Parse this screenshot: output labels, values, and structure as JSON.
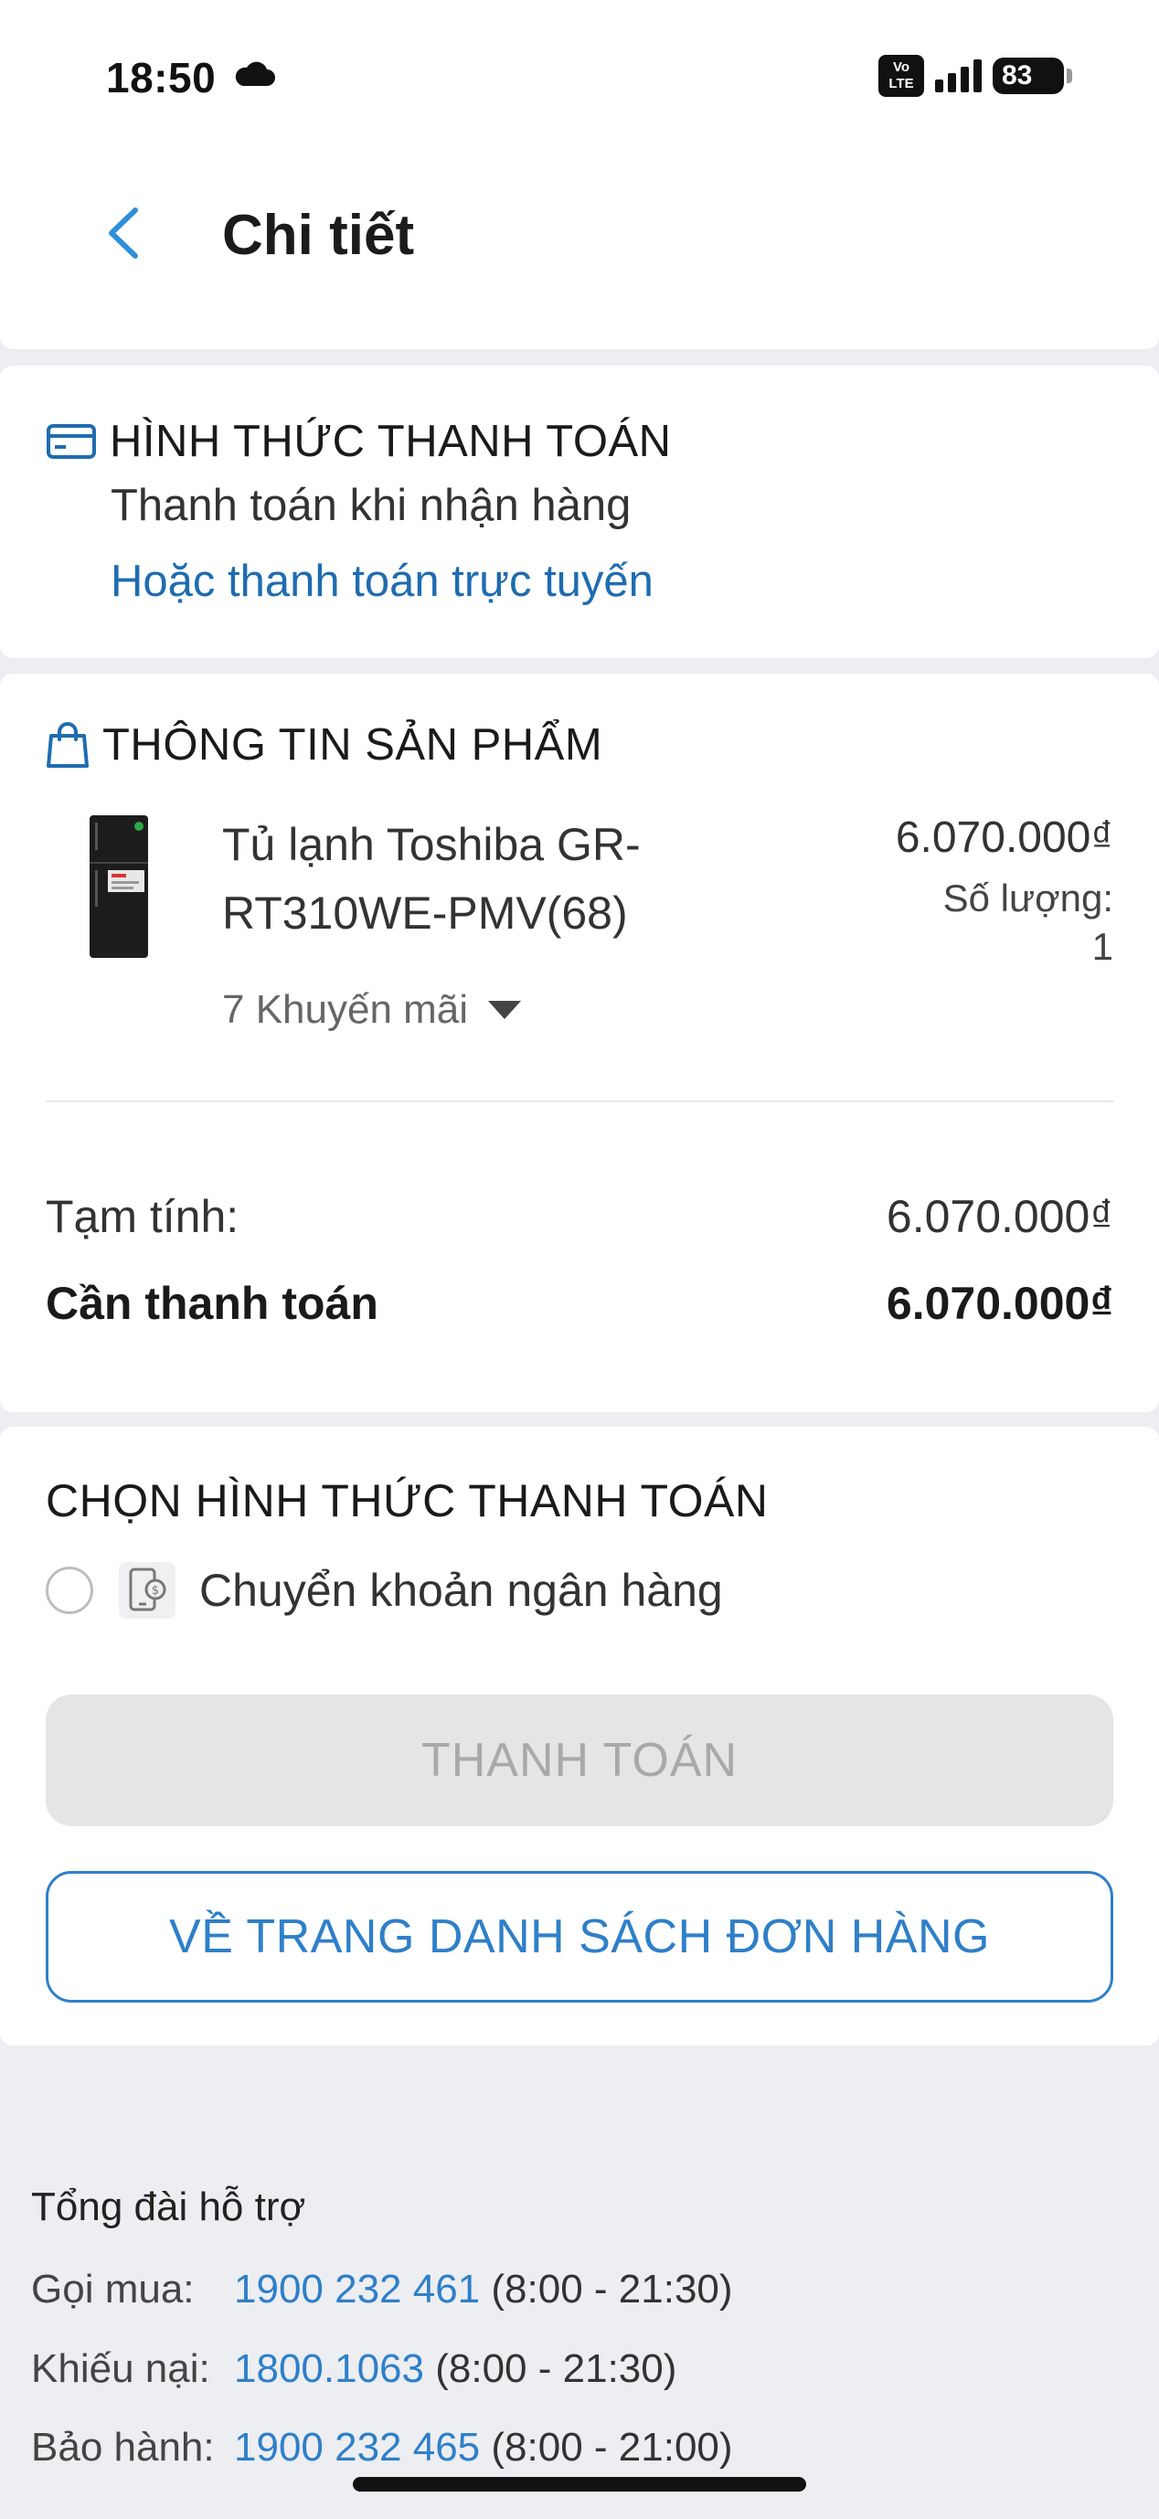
{
  "status_bar": {
    "time": "18:50",
    "network_badge": "VoLTE",
    "network_badge_top": "Vo",
    "network_badge_bottom": "LTE",
    "battery": "83"
  },
  "header": {
    "title": "Chi tiết"
  },
  "payment_method": {
    "title": "HÌNH THỨC THANH TOÁN",
    "method": "Thanh toán khi nhận hàng",
    "online_link": "Hoặc thanh toán trực tuyến"
  },
  "product_info": {
    "title": "THÔNG TIN SẢN PHẨM",
    "item": {
      "name": "Tủ lạnh Toshiba GR-RT310WE-PMV(68)",
      "price": "6.070.000₫",
      "quantity_label": "Số lượng:",
      "quantity": "1",
      "promotions": "7 Khuyến mãi"
    }
  },
  "summary": {
    "subtotal_label": "Tạm tính:",
    "subtotal": "6.070.000₫",
    "total_label": "Cần thanh toán",
    "total": "6.070.000₫"
  },
  "choose_payment": {
    "title": "CHỌN HÌNH THỨC THANH TOÁN",
    "options": [
      {
        "label": "Chuyển khoản ngân hàng",
        "selected": false
      }
    ],
    "pay_button": "THANH TOÁN",
    "orders_button": "VỀ TRANG DANH SÁCH ĐƠN HÀNG"
  },
  "support": {
    "title": "Tổng đài hỗ trợ",
    "lines": [
      {
        "label": "Gọi mua:",
        "number": "1900 232 461",
        "hours": "(8:00 - 21:30)"
      },
      {
        "label": "Khiếu nại:",
        "number": "1800.1063",
        "hours": "(8:00 - 21:30)"
      },
      {
        "label": "Bảo hành:",
        "number": "1900 232 465",
        "hours": "(8:00 - 21:00)"
      }
    ]
  },
  "colors": {
    "accent": "#2f7fc8",
    "link": "#1f6cb0",
    "icon_blue": "#1f6cb0",
    "disabled_bg": "#e5e5e5",
    "page_bg": "#eceef2"
  },
  "icons": [
    "cloud-icon",
    "back-chevron-icon",
    "card-icon",
    "shopping-bag-icon",
    "caret-down-icon",
    "bank-transfer-icon"
  ]
}
